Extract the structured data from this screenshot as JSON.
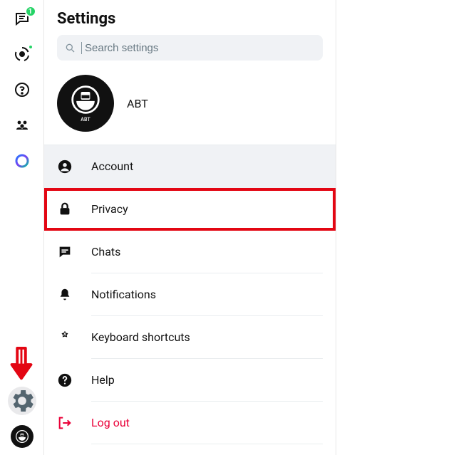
{
  "rail": {
    "chat_badge": "1"
  },
  "settings": {
    "title": "Settings",
    "search_placeholder": "Search settings",
    "profile_name": "ABT",
    "avatar_label": "ABT",
    "items": [
      {
        "key": "account",
        "label": "Account"
      },
      {
        "key": "privacy",
        "label": "Privacy"
      },
      {
        "key": "chats",
        "label": "Chats"
      },
      {
        "key": "notifications",
        "label": "Notifications"
      },
      {
        "key": "keyboard",
        "label": "Keyboard shortcuts"
      },
      {
        "key": "help",
        "label": "Help"
      },
      {
        "key": "logout",
        "label": "Log out"
      }
    ]
  },
  "annotation": {
    "highlight_item": "privacy",
    "arrow_points_to": "settings-gear"
  }
}
